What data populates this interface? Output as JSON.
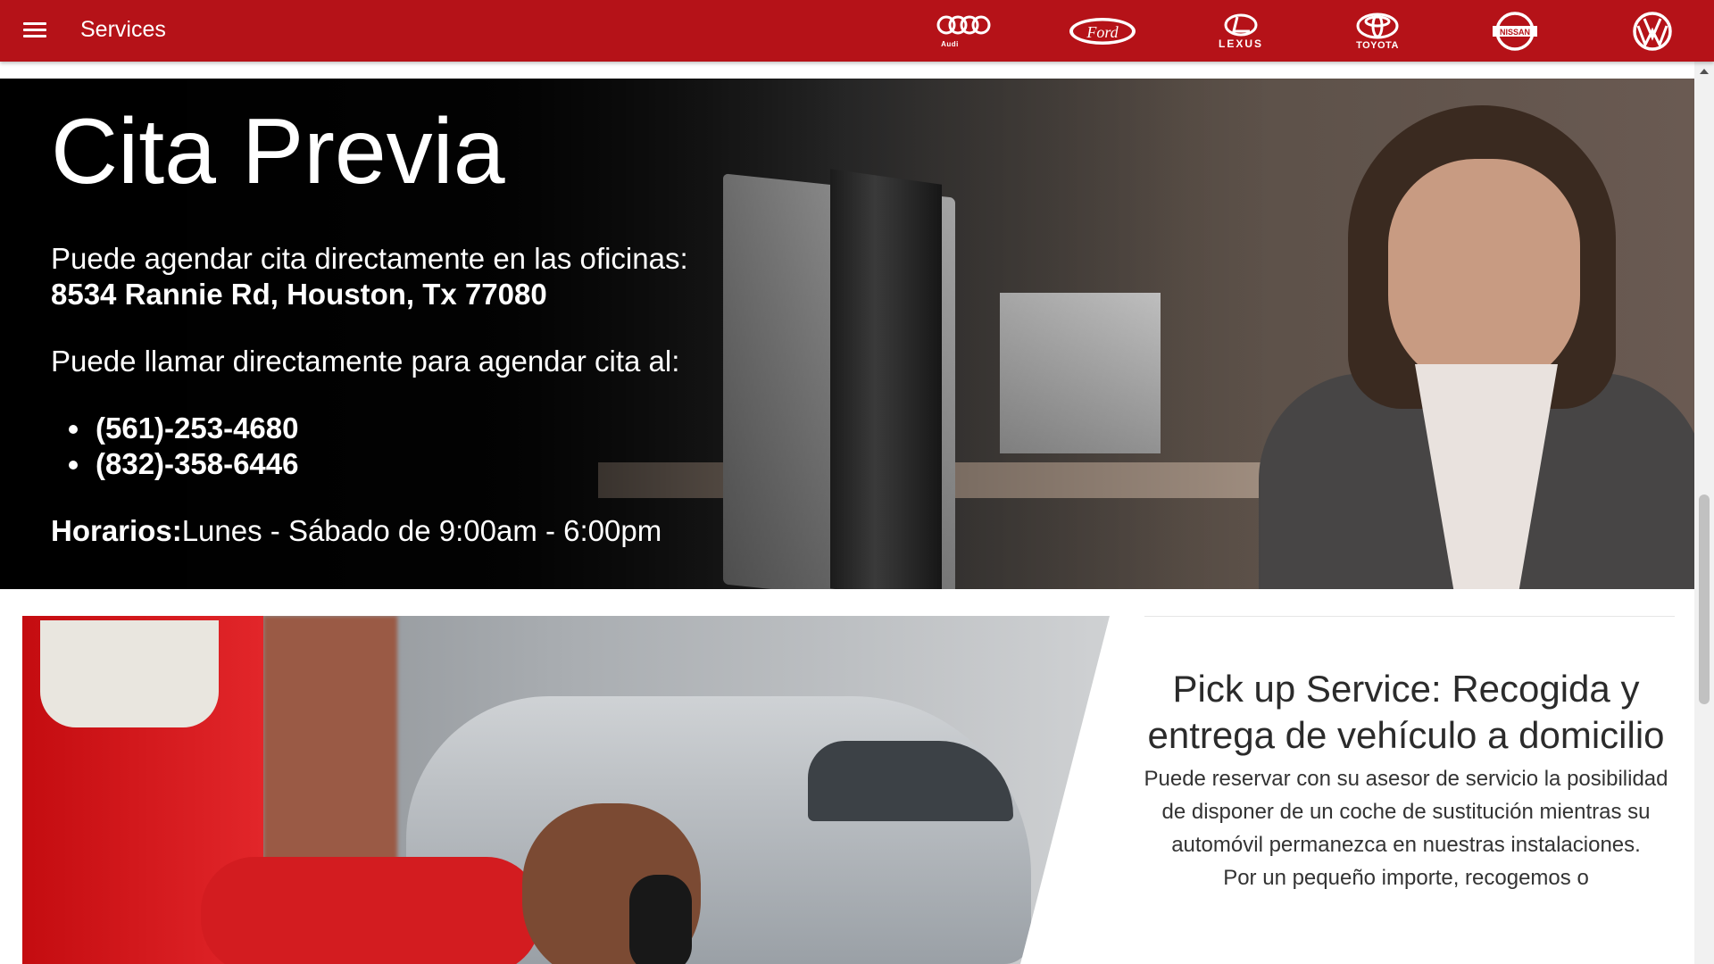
{
  "header": {
    "title": "Services",
    "menu_icon": "hamburger-menu-icon",
    "brands": [
      {
        "name": "audi",
        "caption": "Audi"
      },
      {
        "name": "ford",
        "caption": "Ford"
      },
      {
        "name": "lexus",
        "caption": "LEXUS"
      },
      {
        "name": "toyota",
        "caption": "TOYOTA"
      },
      {
        "name": "nissan",
        "caption": "NISSAN"
      },
      {
        "name": "volkswagen",
        "caption": "VW"
      }
    ],
    "color": "#b51218"
  },
  "hero": {
    "title": "Cita Previa",
    "office_text": "Puede agendar cita directamente en las oficinas:",
    "address": "8534 Rannie Rd, Houston, Tx 77080",
    "call_text": "Puede llamar directamente para agendar cita al:",
    "phones": [
      "(561)-253-4680",
      "(832)-358-6446"
    ],
    "hours_label": "Horarios:",
    "hours_value": "Lunes - Sábado de 9:00am - 6:00pm"
  },
  "pickup": {
    "title": "Pick up Service: Recogida y entrega de vehículo a domicilio",
    "body": "Puede reservar con su asesor de servicio la posibilidad de disponer de un coche de sustitución mientras su automóvil permanezca en nuestras instalaciones.",
    "body2": "Por un pequeño importe, recogemos o"
  }
}
